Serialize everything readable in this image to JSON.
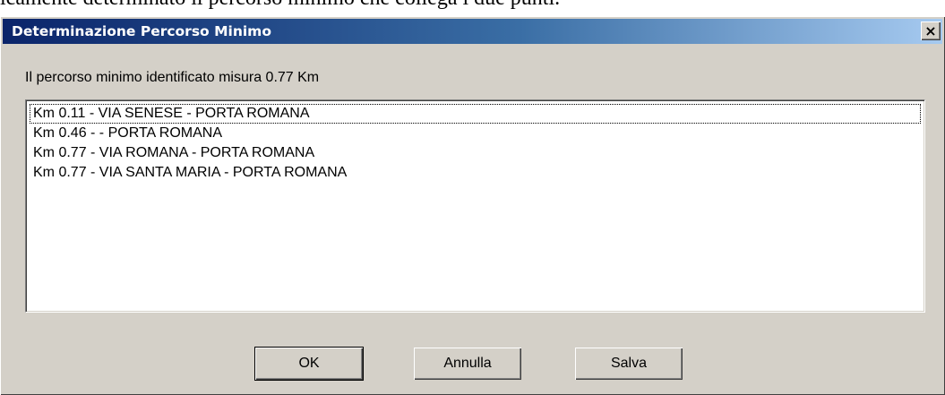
{
  "background": {
    "text": "icamente determinato il percorso minimo che collega i due punti."
  },
  "dialog": {
    "title": "Determinazione Percorso Minimo",
    "close_label": "×",
    "message": "Il percorso minimo identificato misura 0.77 Km",
    "route_list": [
      "Km  0.11 - VIA SENESE - PORTA ROMANA",
      "Km  0.46 -  - PORTA ROMANA",
      "Km  0.77 - VIA ROMANA - PORTA ROMANA",
      "Km  0.77 - VIA SANTA MARIA - PORTA ROMANA"
    ],
    "buttons": {
      "ok": "OK",
      "cancel": "Annulla",
      "save": "Salva"
    }
  },
  "colors": {
    "titlebar_start": "#0a246a",
    "titlebar_end": "#a6caf0",
    "dialog_face": "#d4d0c8"
  }
}
